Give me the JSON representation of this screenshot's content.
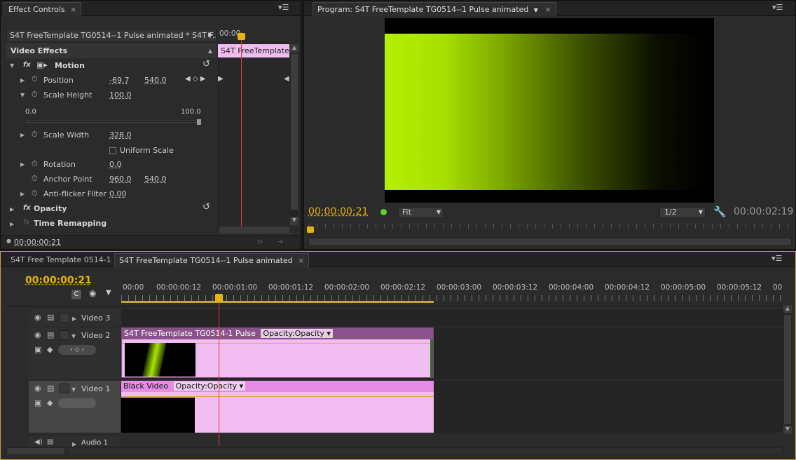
{
  "effect_controls": {
    "tab_label": "Effect Controls",
    "sequence_label": "S4T FreeTemplate TG0514--1 Pulse animated * S4T F...",
    "ruler_time": "00:00",
    "clip_label": "S4T FreeTemplate",
    "section_title": "Video Effects",
    "motion_label": "Motion",
    "properties": {
      "position": {
        "label": "Position",
        "x": "-69.7",
        "y": "540.0"
      },
      "scale_height": {
        "label": "Scale Height",
        "value": "100.0",
        "min": "0.0",
        "max": "100.0",
        "slider_fraction": 1.0
      },
      "scale_width": {
        "label": "Scale Width",
        "value": "328.0"
      },
      "uniform_scale": {
        "label": "Uniform Scale",
        "checked": false
      },
      "rotation": {
        "label": "Rotation",
        "value": "0.0"
      },
      "anchor_point": {
        "label": "Anchor Point",
        "x": "960.0",
        "y": "540.0"
      },
      "anti_flicker": {
        "label": "Anti-flicker Filter",
        "value": "0.00"
      }
    },
    "opacity_label": "Opacity",
    "time_remapping_label": "Time Remapping",
    "current_time": "00:00:00:21"
  },
  "program": {
    "tab_label": "Program: S4T FreeTemplate TG0514--1 Pulse animated",
    "current_time": "00:00:00:21",
    "fit_label": "Fit",
    "resolution_label": "1/2",
    "duration": "00:00:02:19",
    "accent_color": "#b5f000"
  },
  "timeline": {
    "tabs": [
      {
        "label": "S4T Free Template 0514-1",
        "active": false
      },
      {
        "label": "S4T FreeTemplate TG0514--1 Pulse animated",
        "active": true
      }
    ],
    "current_time": "00:00:00:21",
    "ruler": [
      "00:00",
      "00:00:00:12",
      "00:00:01:00",
      "00:00:01:12",
      "00:00:02:00",
      "00:00:02:12",
      "00:00:03:00",
      "00:00:03:12",
      "00:00:04:00",
      "00:00:04:12",
      "00:00:05:00",
      "00:00:05:12",
      "00"
    ],
    "tracks": {
      "video3": "Video 3",
      "video2": "Video 2",
      "video1": "Video 1",
      "audio1": "Audio 1"
    },
    "clips": {
      "v2_name": "S4T FreeTemplate TG0514-1 Pulse",
      "v2_fx": "Opacity:Opacity",
      "v1_name": "Black Video",
      "v1_fx": "Opacity:Opacity"
    },
    "playhead_color": "#e03a2a",
    "clip_color": "#f0bdf0"
  }
}
